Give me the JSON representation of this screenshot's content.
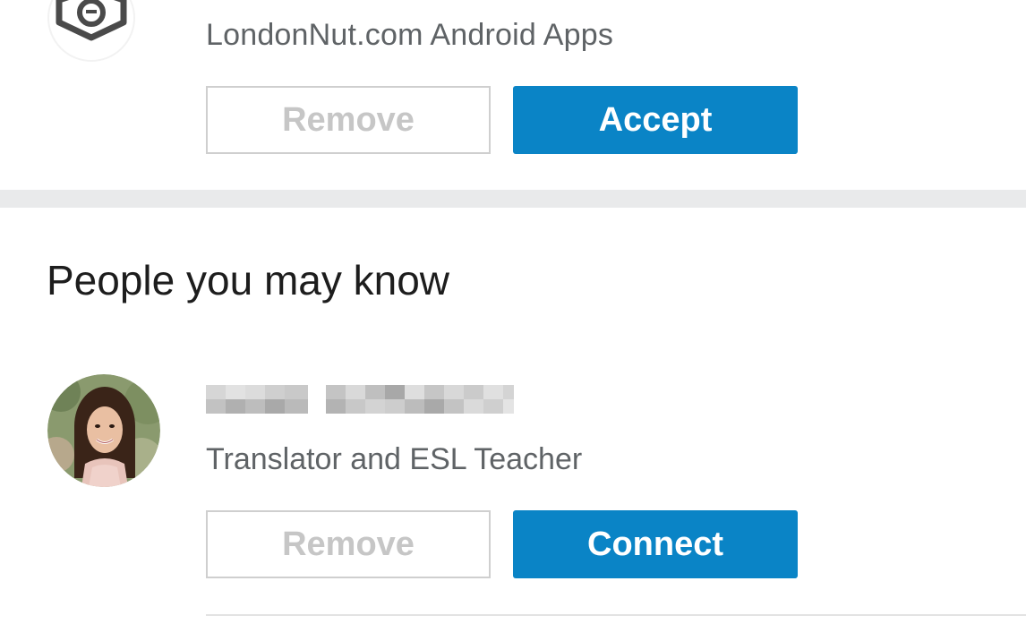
{
  "invitation": {
    "subtitle": "LondonNut.com Android Apps",
    "logo_icon": "shield-badge-icon",
    "remove_label": "Remove",
    "accept_label": "Accept"
  },
  "people_section": {
    "title": "People you may know",
    "person": {
      "avatar": "profile-photo",
      "name_visible": false,
      "headline": "Translator and ESL Teacher",
      "remove_label": "Remove",
      "connect_label": "Connect"
    }
  },
  "colors": {
    "accent": "#0a84c6",
    "outline_button_text": "#c6c6c6",
    "divider": "#e9eaeb",
    "secondary_text": "#5f6366"
  }
}
